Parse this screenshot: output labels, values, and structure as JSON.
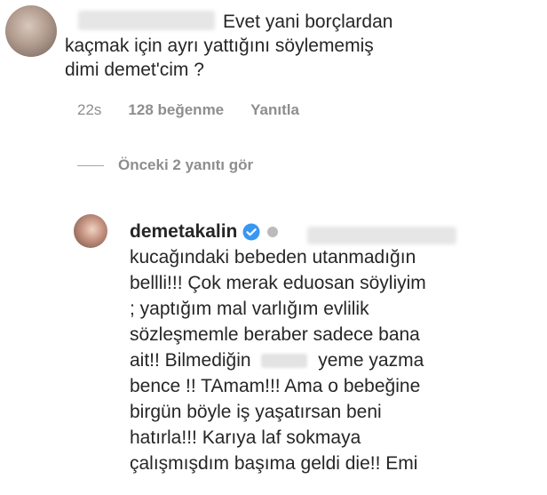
{
  "comment1": {
    "lines": [
      "Evet yani borçlardan",
      "kaçmak için ayrı yattığını söylememiş",
      "dimi demet'cim ?"
    ],
    "time": "22s",
    "likes": "128 beğenme",
    "reply": "Yanıtla"
  },
  "view_replies": "Önceki 2 yanıtı gör",
  "reply1": {
    "username": "demetakalin",
    "lines": [
      "kucağındaki bebeden utanmadığın",
      "bellli!!! Çok merak eduosan söyliyim",
      "; yaptığım mal varlığım evlilik",
      "sözleşmemle beraber sadece bana",
      "ait!! Bilmediğin",
      "yeme yazma",
      "bence !! TAmam!!! Ama o bebeğine",
      "birgün böyle iş yaşatırsan beni",
      "hatırla!!! Karıya laf sokmaya",
      "çalışmışdım başıma geldi die!! Emi"
    ]
  },
  "colors": {
    "text": "#262626",
    "secondary": "#8e8e8e",
    "verified": "#3897f0"
  }
}
